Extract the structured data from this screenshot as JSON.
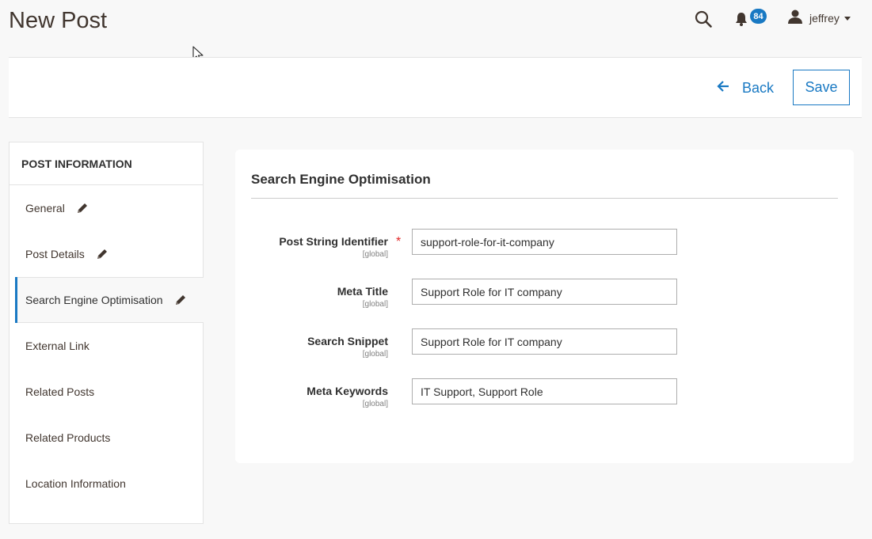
{
  "page": {
    "title": "New Post"
  },
  "header": {
    "notification_count": "84",
    "user_name": "jeffrey"
  },
  "action_bar": {
    "back_label": "Back",
    "save_label": "Save"
  },
  "sidebar": {
    "title": "POST INFORMATION",
    "items": [
      {
        "label": "General",
        "edited": true
      },
      {
        "label": "Post Details",
        "edited": true
      },
      {
        "label": "Search Engine Optimisation",
        "edited": true,
        "active": true
      },
      {
        "label": "External Link",
        "edited": false
      },
      {
        "label": "Related Posts",
        "edited": false
      },
      {
        "label": "Related Products",
        "edited": false
      },
      {
        "label": "Location Information",
        "edited": false
      }
    ]
  },
  "panel": {
    "title": "Search Engine Optimisation",
    "fields": [
      {
        "label": "Post String Identifier",
        "scope": "[global]",
        "value": "support-role-for-it-company",
        "required": true
      },
      {
        "label": "Meta Title",
        "scope": "[global]",
        "value": "Support Role for IT company",
        "required": false
      },
      {
        "label": "Search Snippet",
        "scope": "[global]",
        "value": "Support Role for IT company",
        "required": false
      },
      {
        "label": "Meta Keywords",
        "scope": "[global]",
        "value": "IT Support, Support Role",
        "required": false
      }
    ]
  },
  "colors": {
    "accent": "#1979c3",
    "required": "#e22626"
  }
}
